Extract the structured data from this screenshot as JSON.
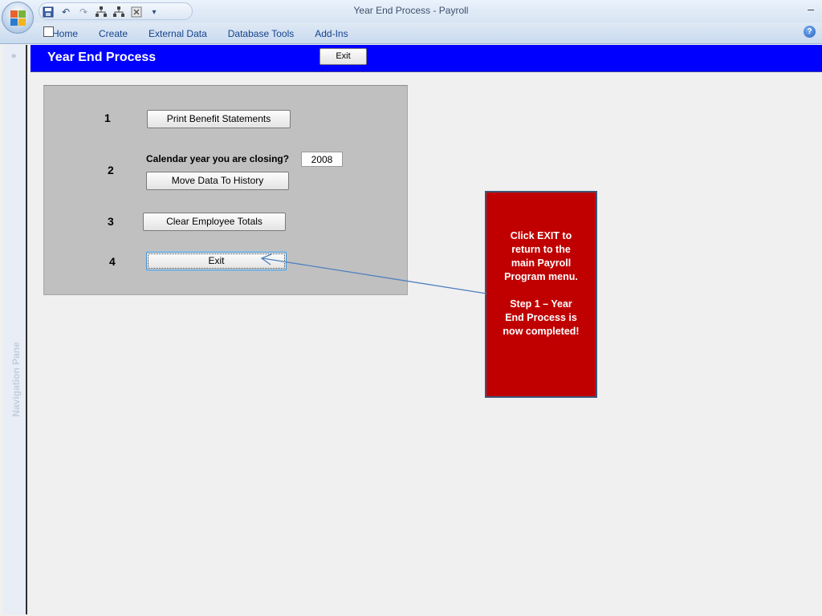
{
  "window": {
    "title": "Year End Process - Payroll",
    "minimize_glyph": "–"
  },
  "quick_access": {
    "icons": [
      "save-icon",
      "undo-icon",
      "redo-icon",
      "relationships-icon",
      "relationships-icon",
      "close-database-icon",
      "customize-dropdown-icon"
    ]
  },
  "ribbon": {
    "tabs": [
      "Home",
      "Create",
      "External Data",
      "Database Tools",
      "Add-Ins"
    ],
    "help_glyph": "?"
  },
  "nav_pane": {
    "label": "Navigation Pane",
    "chevron": "»"
  },
  "form": {
    "title": "Year End Process",
    "header_exit_label": "Exit",
    "steps": [
      {
        "number": "1",
        "button_label": "Print Benefit Statements"
      },
      {
        "number": "2",
        "closing_label": "Calendar year you are closing?",
        "year_value": "2008",
        "button_label": "Move Data To History"
      },
      {
        "number": "3",
        "button_label": "Clear Employee Totals"
      },
      {
        "number": "4",
        "button_label": "Exit"
      }
    ]
  },
  "callout": {
    "text": "Click EXIT to\nreturn to the\nmain Payroll\nProgram menu.\n\nStep 1 – Year\nEnd Process is\nnow completed!",
    "background": "#c00000"
  },
  "colors": {
    "form_header": "#0000ff",
    "panel": "#c0c0c0"
  }
}
